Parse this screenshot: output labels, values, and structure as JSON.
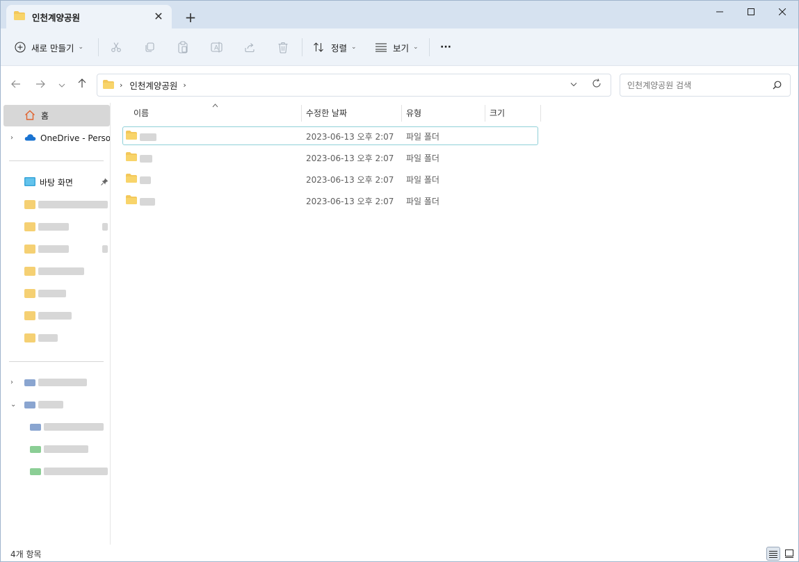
{
  "window": {
    "tab_title": "인천계양공원",
    "new_tab_label": "+",
    "tab_close_label": "✕"
  },
  "toolbar": {
    "new_label": "새로 만들기",
    "sort_label": "정렬",
    "view_label": "보기",
    "more_label": "···"
  },
  "address": {
    "crumb": "인천계양공원",
    "search_placeholder": "인천계양공원 검색"
  },
  "sidebar": {
    "home_label": "홈",
    "onedrive_label": "OneDrive - Personal",
    "desktop_label": "바탕 화면"
  },
  "columns": {
    "name": "이름",
    "modified": "수정한 날짜",
    "type": "유형",
    "size": "크기"
  },
  "files": [
    {
      "modified": "2023-06-13 오후 2:07",
      "type": "파일 폴더"
    },
    {
      "modified": "2023-06-13 오후 2:07",
      "type": "파일 폴더"
    },
    {
      "modified": "2023-06-13 오후 2:07",
      "type": "파일 폴더"
    },
    {
      "modified": "2023-06-13 오후 2:07",
      "type": "파일 폴더"
    }
  ],
  "status": {
    "item_count": "4개 항목"
  },
  "colors": {
    "folder": "#f3c85b",
    "accent": "#0078d4",
    "titlebar": "#d6e2f0",
    "cmdbar": "#eef3f9"
  }
}
